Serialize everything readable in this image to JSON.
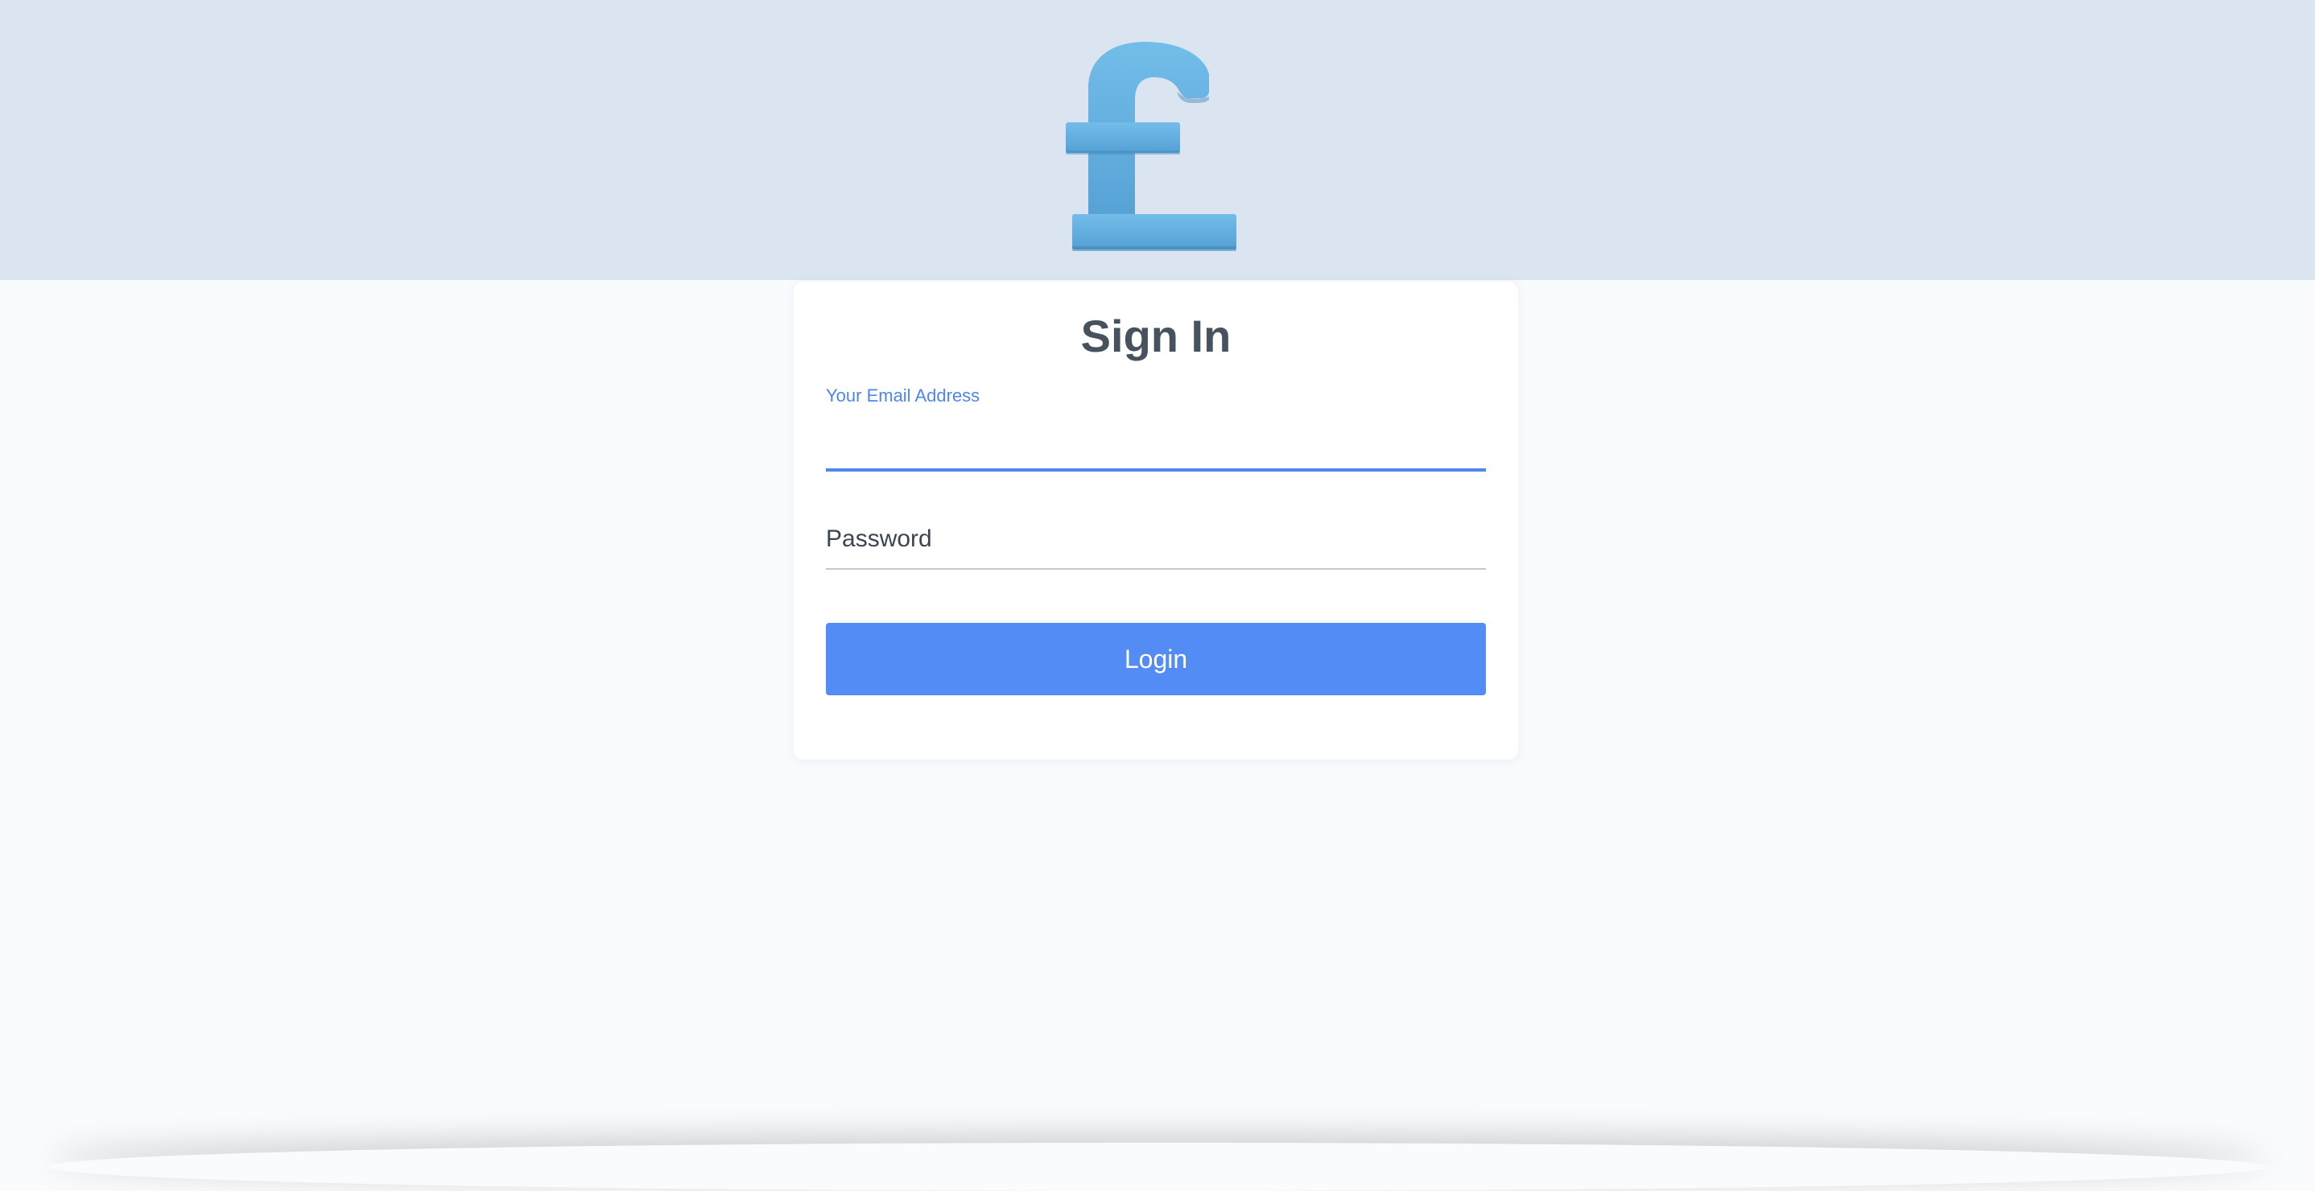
{
  "brand": {
    "logo_icon": "pound-sign-icon",
    "colors": {
      "header_background": "#dae5f1",
      "logo_blue": "#5ea9df",
      "accent": "#538cf5"
    }
  },
  "signin": {
    "title": "Sign In",
    "email": {
      "label": "Your Email Address",
      "value": ""
    },
    "password": {
      "label": "Password"
    },
    "login_button_label": "Login"
  }
}
